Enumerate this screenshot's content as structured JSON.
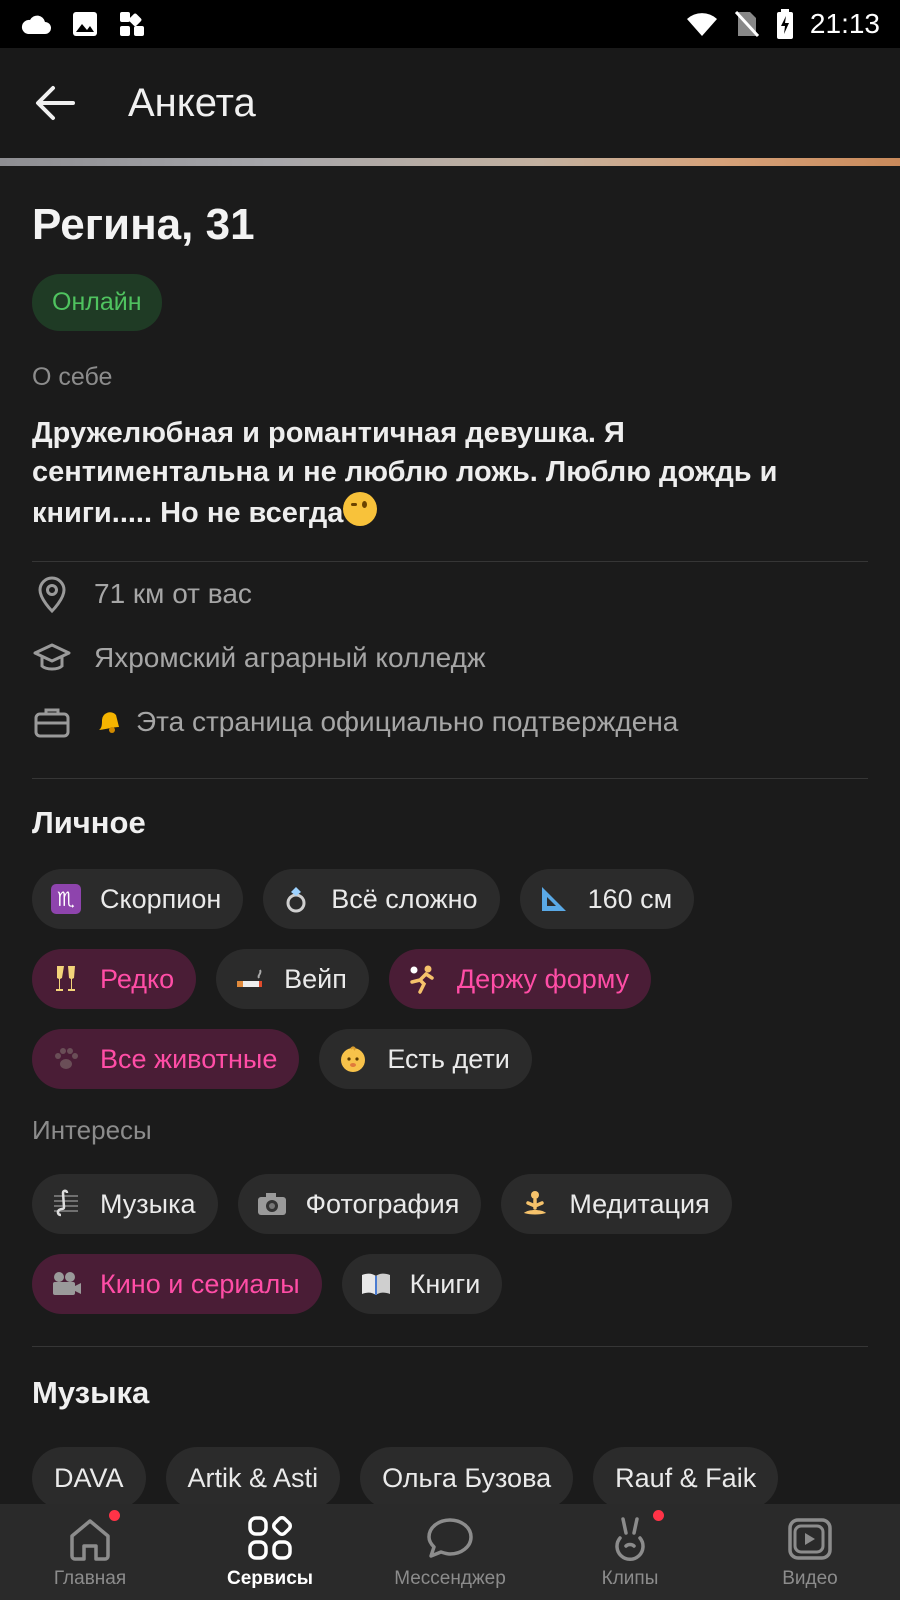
{
  "status_bar": {
    "time": "21:13"
  },
  "header": {
    "title": "Анкета"
  },
  "profile": {
    "name_age": "Регина, 31",
    "online_badge": "Онлайн",
    "about_label": "О себе",
    "about_text": "Дружелюбная и романтичная девушка. Я сентиментальна и не люблю ложь. Люблю дождь и книги..... Но не всегда"
  },
  "info": [
    {
      "icon": "location-icon",
      "text": "71 км от вас"
    },
    {
      "icon": "graduation-cap-icon",
      "text": "Яхромский аграрный колледж"
    },
    {
      "icon": "briefcase-icon",
      "text": "Эта страница официально подтверждена"
    }
  ],
  "personal": {
    "title": "Личное",
    "chips": [
      {
        "icon": "scorpio-icon",
        "label": "Скорпион",
        "highlight": false
      },
      {
        "icon": "ring-icon",
        "label": "Всё сложно",
        "highlight": false
      },
      {
        "icon": "ruler-icon",
        "label": "160 см",
        "highlight": false
      },
      {
        "icon": "champagne-icon",
        "label": "Редко",
        "highlight": true
      },
      {
        "icon": "cigarette-icon",
        "label": "Вейп",
        "highlight": false
      },
      {
        "icon": "handball-icon",
        "label": "Держу форму",
        "highlight": true
      },
      {
        "icon": "paw-icon",
        "label": "Все животные",
        "highlight": true
      },
      {
        "icon": "baby-icon",
        "label": "Есть дети",
        "highlight": false
      }
    ]
  },
  "interests": {
    "label": "Интересы",
    "chips": [
      {
        "icon": "music-score-icon",
        "label": "Музыка",
        "highlight": false
      },
      {
        "icon": "camera-icon",
        "label": "Фотография",
        "highlight": false
      },
      {
        "icon": "meditation-icon",
        "label": "Медитация",
        "highlight": false
      },
      {
        "icon": "movie-camera-icon",
        "label": "Кино и сериалы",
        "highlight": true
      },
      {
        "icon": "book-icon",
        "label": "Книги",
        "highlight": false
      }
    ]
  },
  "music": {
    "title": "Музыка",
    "artists": [
      "DAVA",
      "Artik & Asti",
      "Ольга Бузова",
      "Rauf & Faik"
    ]
  },
  "bottom_nav": [
    {
      "icon": "home-icon",
      "label": "Главная",
      "active": false,
      "dot": true
    },
    {
      "icon": "services-icon",
      "label": "Сервисы",
      "active": true,
      "dot": false
    },
    {
      "icon": "messenger-icon",
      "label": "Мессенджер",
      "active": false,
      "dot": false
    },
    {
      "icon": "clips-icon",
      "label": "Клипы",
      "active": false,
      "dot": true
    },
    {
      "icon": "video-icon",
      "label": "Видео",
      "active": false,
      "dot": false
    }
  ],
  "colors": {
    "background": "#1b1b1b",
    "online_green": "#4fc35f",
    "highlight_pink": "#ff4da6",
    "notification_red": "#ff3347"
  }
}
